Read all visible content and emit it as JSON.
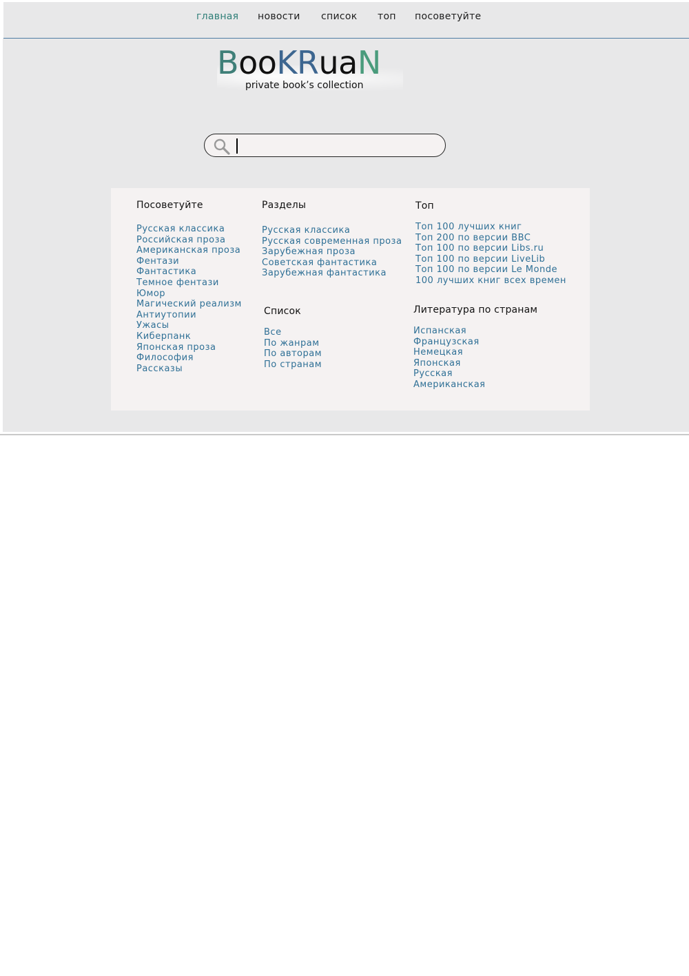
{
  "nav": {
    "items": [
      {
        "label": "главная",
        "active": true
      },
      {
        "label": "новости"
      },
      {
        "label": "список"
      },
      {
        "label": "топ"
      },
      {
        "label": "посоветуйте"
      }
    ]
  },
  "logo": {
    "letters": [
      {
        "ch": "B",
        "color": "#3f7f78"
      },
      {
        "ch": "o",
        "color": "#111111"
      },
      {
        "ch": "o",
        "color": "#111111"
      },
      {
        "ch": "K",
        "color": "#3d6690"
      },
      {
        "ch": "R",
        "color": "#3d6690"
      },
      {
        "ch": "u",
        "color": "#111111"
      },
      {
        "ch": "a",
        "color": "#111111"
      },
      {
        "ch": "N",
        "color": "#4a9b7c"
      }
    ],
    "tagline": "private book’s collection"
  },
  "search": {
    "value": "",
    "placeholder": ""
  },
  "sections": {
    "recommend": {
      "title": "Посоветуйте",
      "links": [
        "Русская классика",
        "Российская проза",
        "Американская проза",
        "Фентази",
        "Фантастика",
        "Темное фентази",
        "Юмор",
        "Магический реализм",
        "Антиутопии",
        "Ужасы",
        "Киберпанк",
        "Японская проза",
        "Философия",
        "Рассказы"
      ]
    },
    "divisions": {
      "title": "Разделы",
      "links": [
        "Русская классика",
        "Русская современная проза",
        "Зарубежная проза",
        "Советская фантастика",
        "Зарубежная фантастика"
      ]
    },
    "list": {
      "title": "Список",
      "links": [
        "Все",
        "По жанрам",
        "По авторам",
        "По странам"
      ]
    },
    "top": {
      "title": "Топ",
      "links": [
        "Топ 100 лучших книг",
        "Топ 200 по  версии BBC",
        "Топ 100  по версии Libs.ru",
        "Топ 100 по версии LiveLib",
        "Топ 100  по версии Le Monde",
        "100 лучших книг всех времен"
      ]
    },
    "countries": {
      "title": "Литература по странам",
      "links": [
        "Испанская",
        "Французская",
        "Немецкая",
        "Японская",
        "Русская",
        "Американская"
      ]
    }
  },
  "colors": {
    "link": "#2f7096",
    "active_nav": "#2f7f78",
    "panel_bg": "#f5f2f2",
    "page_bg": "#e8e8e9"
  }
}
